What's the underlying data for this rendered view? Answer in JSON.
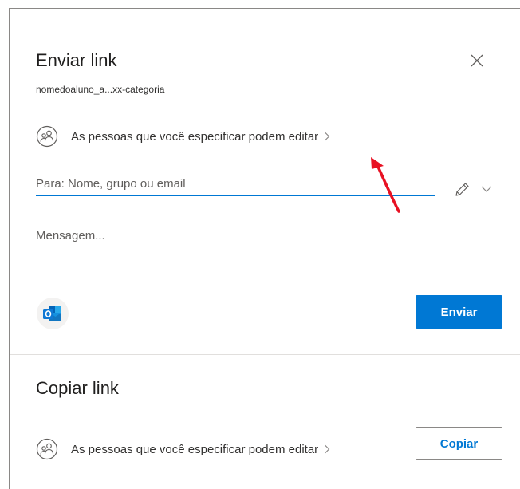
{
  "send_link": {
    "title": "Enviar link",
    "file_name": "nomedoaluno_a...xx-categoria",
    "permission_text": "As pessoas que você especificar podem editar",
    "to_placeholder": "Para: Nome, grupo ou email",
    "to_value": "",
    "message_placeholder": "Mensagem...",
    "message_value": "",
    "send_label": "Enviar"
  },
  "copy_link": {
    "title": "Copiar link",
    "permission_text": "As pessoas que você especificar podem editar",
    "copy_label": "Copiar"
  },
  "icons": {
    "close": "close-icon",
    "people": "people-icon",
    "chevron_right": "chevron-right-icon",
    "pencil": "pencil-icon",
    "chevron_down": "chevron-down-icon",
    "outlook": "outlook-icon",
    "annotation_arrow": "red-arrow-annotation"
  },
  "colors": {
    "accent": "#0078d4",
    "annotation": "#e81123",
    "text_primary": "#201f1e",
    "text_secondary": "#605e5c",
    "divider": "#e1dfdd"
  }
}
